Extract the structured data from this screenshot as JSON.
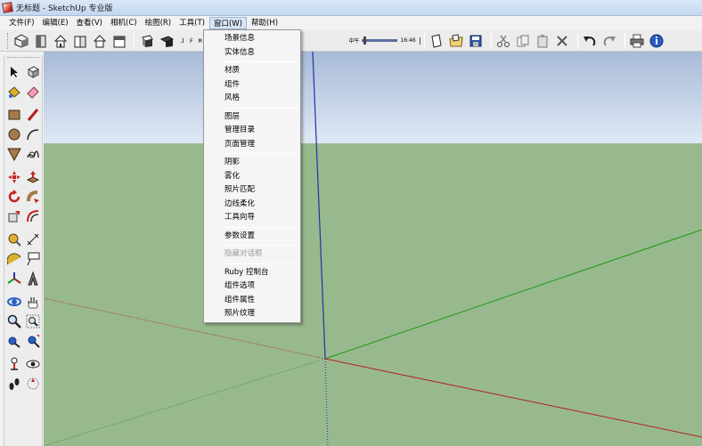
{
  "window": {
    "title": "无标题 - SketchUp 专业版"
  },
  "menubar": {
    "items": [
      {
        "label": "文件(F)",
        "name": "menu-file"
      },
      {
        "label": "编辑(E)",
        "name": "menu-edit"
      },
      {
        "label": "查看(V)",
        "name": "menu-view"
      },
      {
        "label": "相机(C)",
        "name": "menu-camera"
      },
      {
        "label": "绘图(R)",
        "name": "menu-draw"
      },
      {
        "label": "工具(T)",
        "name": "menu-tools"
      },
      {
        "label": "窗口(W)",
        "name": "menu-window",
        "open": true
      },
      {
        "label": "帮助(H)",
        "name": "menu-help"
      }
    ]
  },
  "toolbar": {
    "months": "J F M A",
    "time_label": "中午",
    "time_value": "16:46"
  },
  "window_menu": {
    "groups": [
      [
        {
          "label": "场景信息"
        },
        {
          "label": "实体信息"
        }
      ],
      [
        {
          "label": "材质"
        },
        {
          "label": "组件"
        },
        {
          "label": "风格"
        }
      ],
      [
        {
          "label": "图层"
        },
        {
          "label": "管理目录"
        },
        {
          "label": "页面管理"
        }
      ],
      [
        {
          "label": "阴影"
        },
        {
          "label": "雾化"
        },
        {
          "label": "照片匹配"
        },
        {
          "label": "边线柔化"
        },
        {
          "label": "工具向导"
        }
      ],
      [
        {
          "label": "参数设置"
        }
      ],
      [
        {
          "label": "隐藏对话框",
          "disabled": true
        }
      ],
      [
        {
          "label": "Ruby 控制台"
        },
        {
          "label": "组件选项"
        },
        {
          "label": "组件属性"
        },
        {
          "label": "照片纹理"
        }
      ]
    ]
  },
  "colors": {
    "sky_top": "#a8bad7",
    "sky_bottom": "#dfe9f5",
    "ground": "#98b98d",
    "axis_red": "#b22020",
    "axis_green": "#1a9a1a",
    "axis_blue": "#2233aa"
  }
}
